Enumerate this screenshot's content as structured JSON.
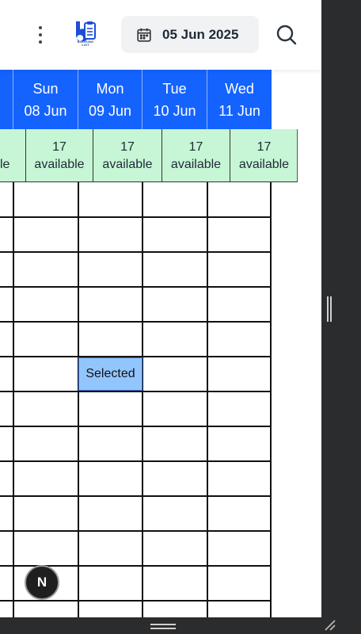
{
  "header": {
    "logo_caption": "BOOKING\nLIST",
    "date_label": "05 Jun 2025"
  },
  "days": [
    {
      "weekday": "Sun",
      "date": "08 Jun",
      "available": "17",
      "available_word": "available"
    },
    {
      "weekday": "Mon",
      "date": "09 Jun",
      "available": "17",
      "available_word": "available"
    },
    {
      "weekday": "Tue",
      "date": "10 Jun",
      "available": "17",
      "available_word": "available"
    },
    {
      "weekday": "Wed",
      "date": "11 Jun",
      "available": "17",
      "available_word": "available"
    }
  ],
  "partial_left_available_suffix": "le",
  "selection": {
    "label": "Selected"
  },
  "floating_badge": {
    "letter": "N"
  },
  "colors": {
    "header_blue": "#1463ff",
    "available_green": "#c6f6d5",
    "selected_blue": "#93c5fd",
    "panel_dark": "#2b2c2e"
  }
}
